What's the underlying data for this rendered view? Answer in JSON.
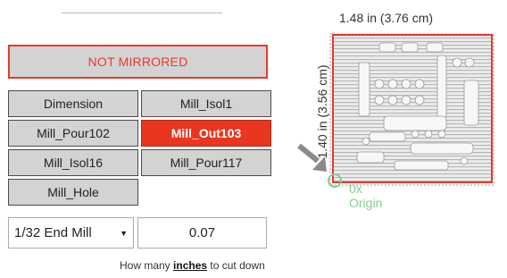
{
  "mirror": {
    "label": "NOT MIRRORED"
  },
  "layers": [
    {
      "label": "Dimension",
      "active": false
    },
    {
      "label": "Mill_Isol1",
      "active": false
    },
    {
      "label": "Mill_Pour102",
      "active": false
    },
    {
      "label": "Mill_Out103",
      "active": true
    },
    {
      "label": "Mill_Isol16",
      "active": false
    },
    {
      "label": "Mill_Pour117",
      "active": false
    },
    {
      "label": "Mill_Hole",
      "active": false
    }
  ],
  "tool_select": {
    "value": "1/32 End Mill"
  },
  "depth_input": {
    "value": "0.07"
  },
  "hint": {
    "prefix": "How many ",
    "emphasis": "inches",
    "suffix": " to cut down"
  },
  "preview": {
    "width_label": "1.48 in (3.76 cm)",
    "height_label": "1.40 in (3.56 cm)",
    "origin_line1": "0x",
    "origin_line2": "Origin",
    "icons": [
      "arrow-icon",
      "origin-marker-icon"
    ]
  },
  "colors": {
    "accent_red": "#e8392a",
    "active_red": "#e8361f",
    "button_gray": "#d3d3d3",
    "origin_green": "#7fcf8c"
  }
}
